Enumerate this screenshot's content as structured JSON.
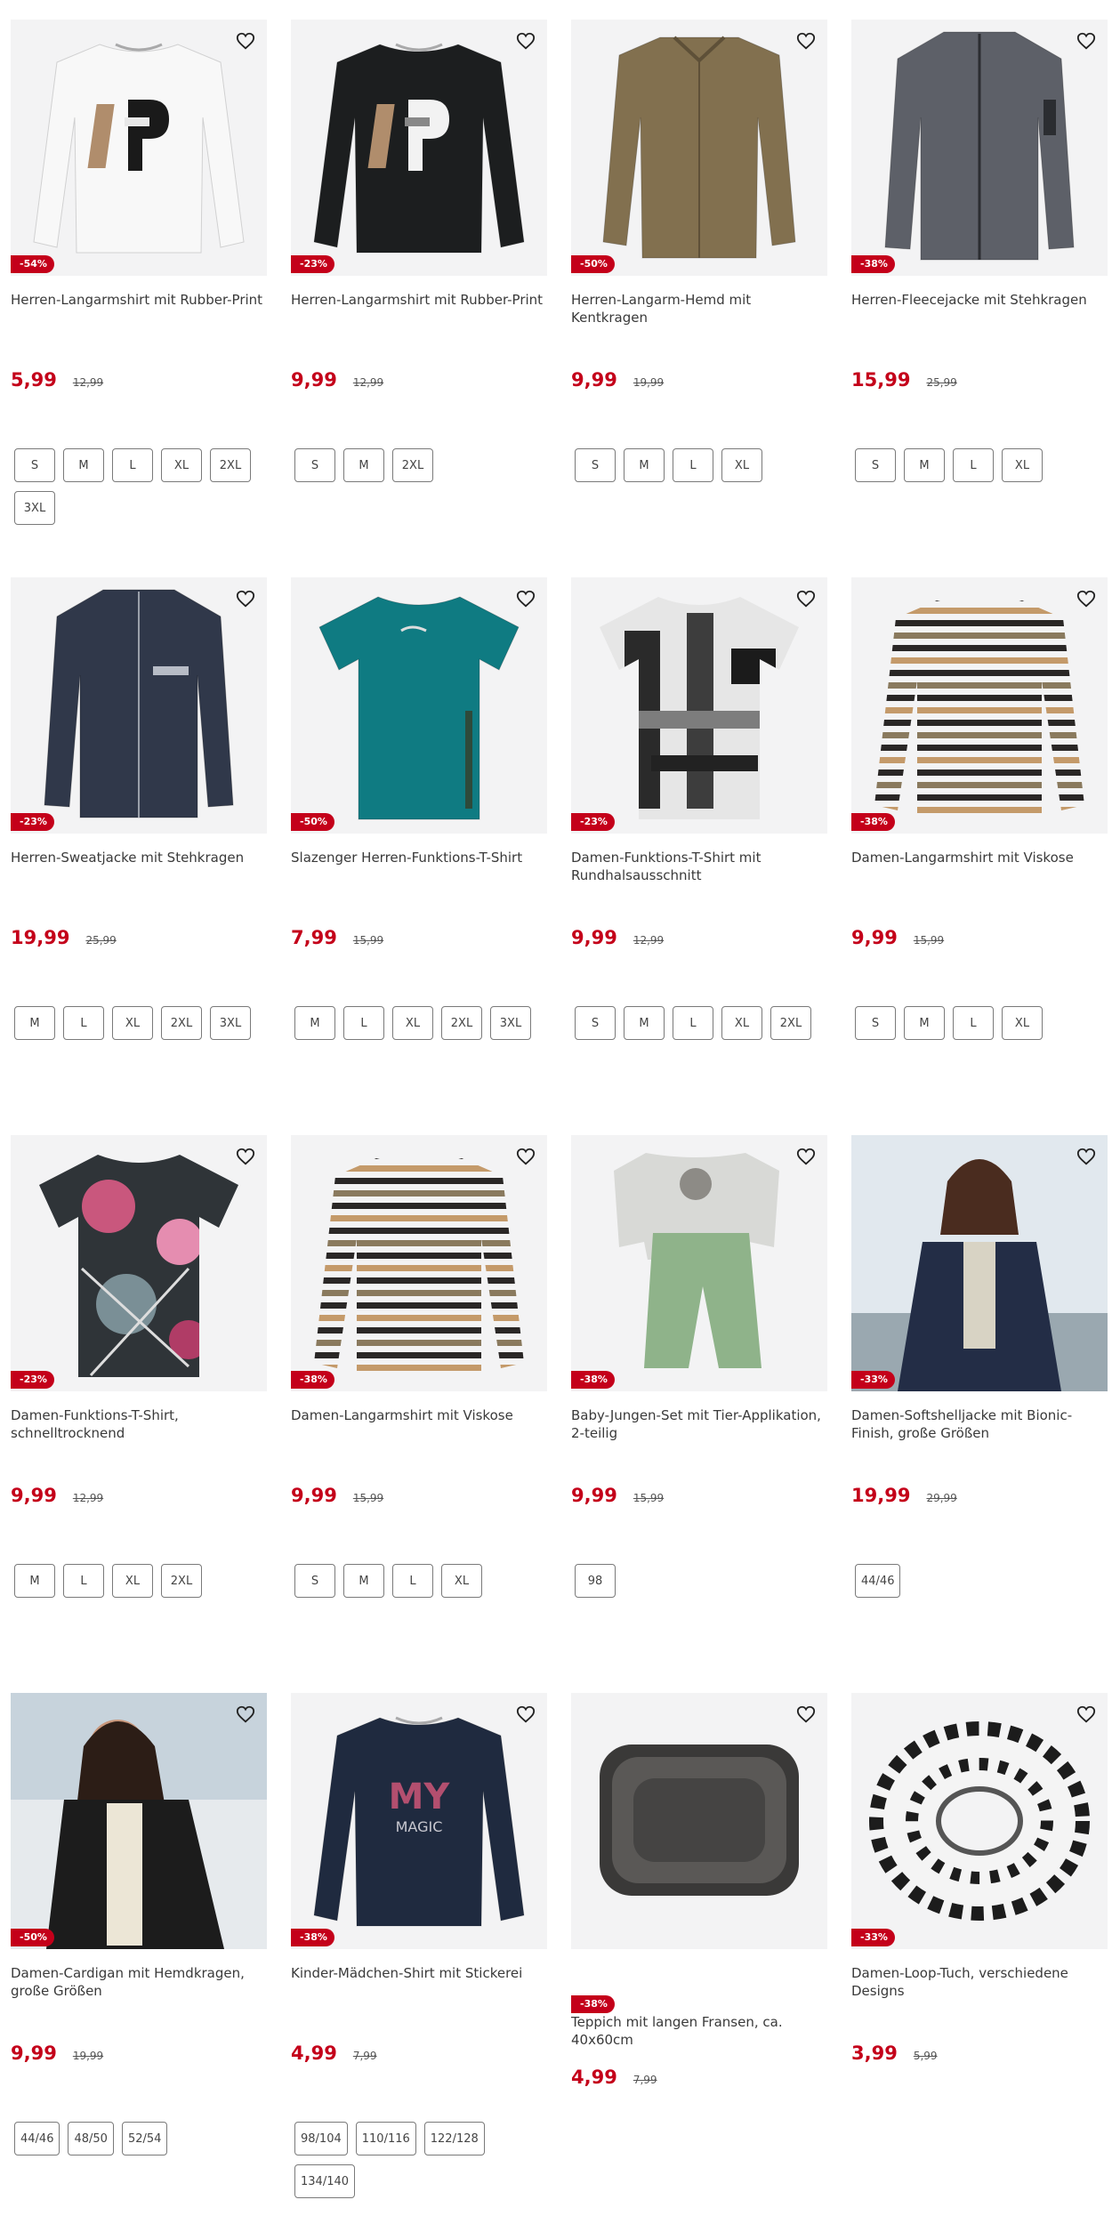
{
  "colors": {
    "accent": "#c4001a",
    "image_bg": "#f3f3f4"
  },
  "products": [
    {
      "title": "Herren-Langarmshirt mit Rubber-Print",
      "price": "5,99",
      "old_price": "12,99",
      "discount": "-54%",
      "sizes": [
        "S",
        "M",
        "L",
        "XL",
        "2XL",
        "3XL"
      ],
      "image": "white-longsleeve-print"
    },
    {
      "title": "Herren-Langarmshirt mit Rubber-Print",
      "price": "9,99",
      "old_price": "12,99",
      "discount": "-23%",
      "sizes": [
        "S",
        "M",
        "2XL"
      ],
      "image": "black-longsleeve-print"
    },
    {
      "title": "Herren-Langarm-Hemd mit Kentkragen",
      "price": "9,99",
      "old_price": "19,99",
      "discount": "-50%",
      "sizes": [
        "S",
        "M",
        "L",
        "XL"
      ],
      "image": "brown-shirt"
    },
    {
      "title": "Herren-Fleecejacke mit Stehkragen",
      "price": "15,99",
      "old_price": "25,99",
      "discount": "-38%",
      "sizes": [
        "S",
        "M",
        "L",
        "XL"
      ],
      "image": "grey-fleece-jacket"
    },
    {
      "title": "Herren-Sweatjacke mit Stehkragen",
      "price": "19,99",
      "old_price": "25,99",
      "discount": "-23%",
      "sizes": [
        "M",
        "L",
        "XL",
        "2XL",
        "3XL"
      ],
      "image": "navy-sweat-jacket"
    },
    {
      "title": "Slazenger Herren-Funktions-T-Shirt",
      "price": "7,99",
      "old_price": "15,99",
      "discount": "-50%",
      "sizes": [
        "M",
        "L",
        "XL",
        "2XL",
        "3XL"
      ],
      "image": "teal-tshirt"
    },
    {
      "title": "Damen-Funktions-T-Shirt mit Rundhalsausschnitt",
      "price": "9,99",
      "old_price": "12,99",
      "discount": "-23%",
      "sizes": [
        "S",
        "M",
        "L",
        "XL",
        "2XL"
      ],
      "image": "pattern-tshirt"
    },
    {
      "title": "Damen-Langarmshirt mit Viskose",
      "price": "9,99",
      "old_price": "15,99",
      "discount": "-38%",
      "sizes": [
        "S",
        "M",
        "L",
        "XL"
      ],
      "image": "striped-longsleeve"
    },
    {
      "title": "Damen-Funktions-T-Shirt, schnelltrocknend",
      "price": "9,99",
      "old_price": "12,99",
      "discount": "-23%",
      "sizes": [
        "M",
        "L",
        "XL",
        "2XL"
      ],
      "image": "floral-tshirt"
    },
    {
      "title": "Damen-Langarmshirt mit Viskose",
      "price": "9,99",
      "old_price": "15,99",
      "discount": "-38%",
      "sizes": [
        "S",
        "M",
        "L",
        "XL"
      ],
      "image": "striped-longsleeve"
    },
    {
      "title": "Baby-Jungen-Set mit Tier-Applikation, 2-teilig",
      "price": "9,99",
      "old_price": "15,99",
      "discount": "-38%",
      "sizes": [
        "98"
      ],
      "image": "baby-set"
    },
    {
      "title": "Damen-Softshelljacke mit Bionic-Finish, große Größen",
      "price": "19,99",
      "old_price": "29,99",
      "discount": "-33%",
      "sizes": [
        "44/46"
      ],
      "image": "woman-softshell"
    },
    {
      "title": "Damen-Cardigan mit Hemdkragen, große Größen",
      "price": "9,99",
      "old_price": "19,99",
      "discount": "-50%",
      "sizes": [
        "44/46",
        "48/50",
        "52/54"
      ],
      "image": "woman-cardigan"
    },
    {
      "title": "Kinder-Mädchen-Shirt mit Stickerei",
      "price": "4,99",
      "old_price": "7,99",
      "discount": "-38%",
      "sizes": [
        "98/104",
        "110/116",
        "122/128",
        "134/140"
      ],
      "image": "girls-shirt"
    },
    {
      "title": "Teppich mit langen Fransen, ca. 40x60cm",
      "price": "4,99",
      "old_price": "7,99",
      "discount": "-38%",
      "sizes": [],
      "image": "fur-rug"
    },
    {
      "title": "Damen-Loop-Tuch, verschiedene Designs",
      "price": "3,99",
      "old_price": "5,99",
      "discount": "-33%",
      "sizes": [],
      "image": "zebra-scarf"
    }
  ]
}
